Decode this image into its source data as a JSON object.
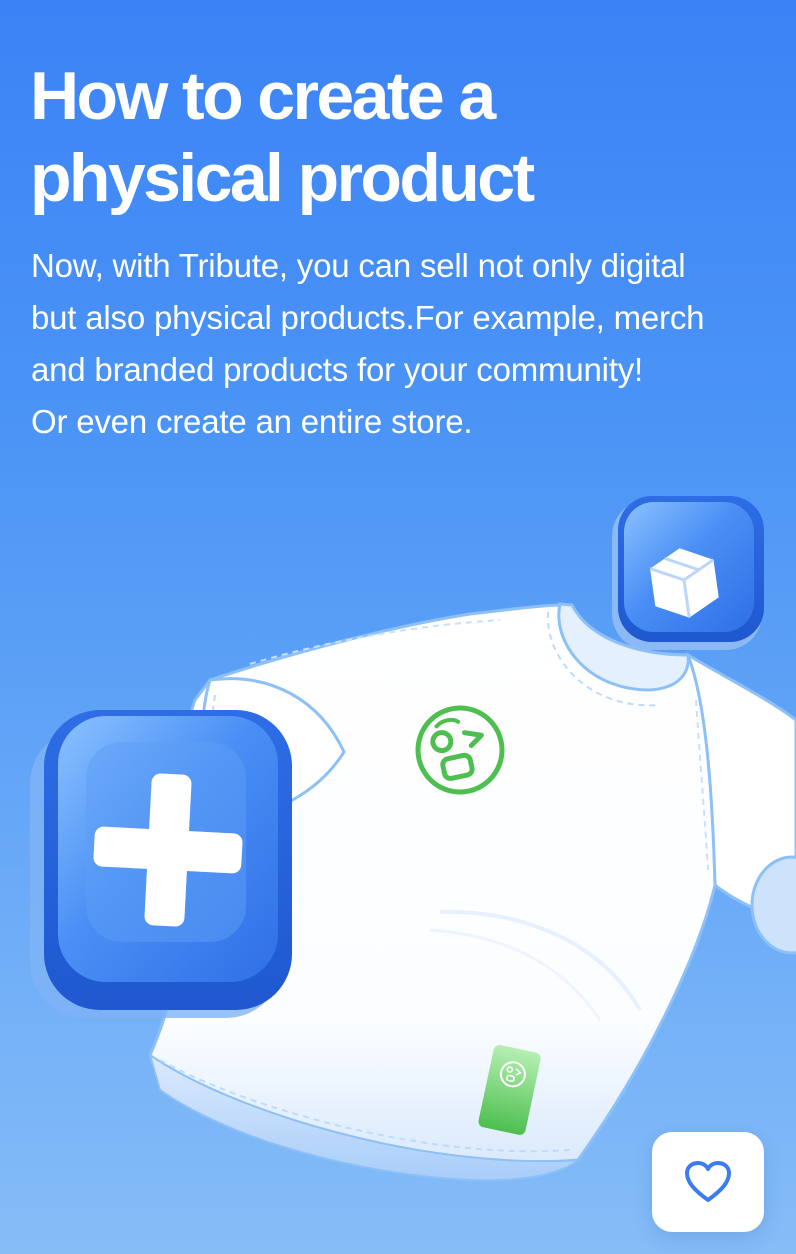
{
  "article": {
    "title_line1": "How to create a",
    "title_line2": "physical product",
    "description_lines": [
      "Now, with Tribute, you can sell not only digital",
      "but also physical products.For example, merch",
      "and branded products for your community!",
      "Or even create an entire store."
    ]
  },
  "illustration": {
    "subject": "t-shirt-icon",
    "badges": [
      "plus-icon",
      "box-icon"
    ],
    "logo": "winking-face-logo"
  },
  "actions": {
    "like_icon": "heart-icon"
  },
  "colors": {
    "background_top": "#3b82f6",
    "background_bottom": "#86bdf7",
    "accent_blue": "#3b7cf2",
    "logo_green": "#4cbf4f",
    "white": "#ffffff"
  }
}
